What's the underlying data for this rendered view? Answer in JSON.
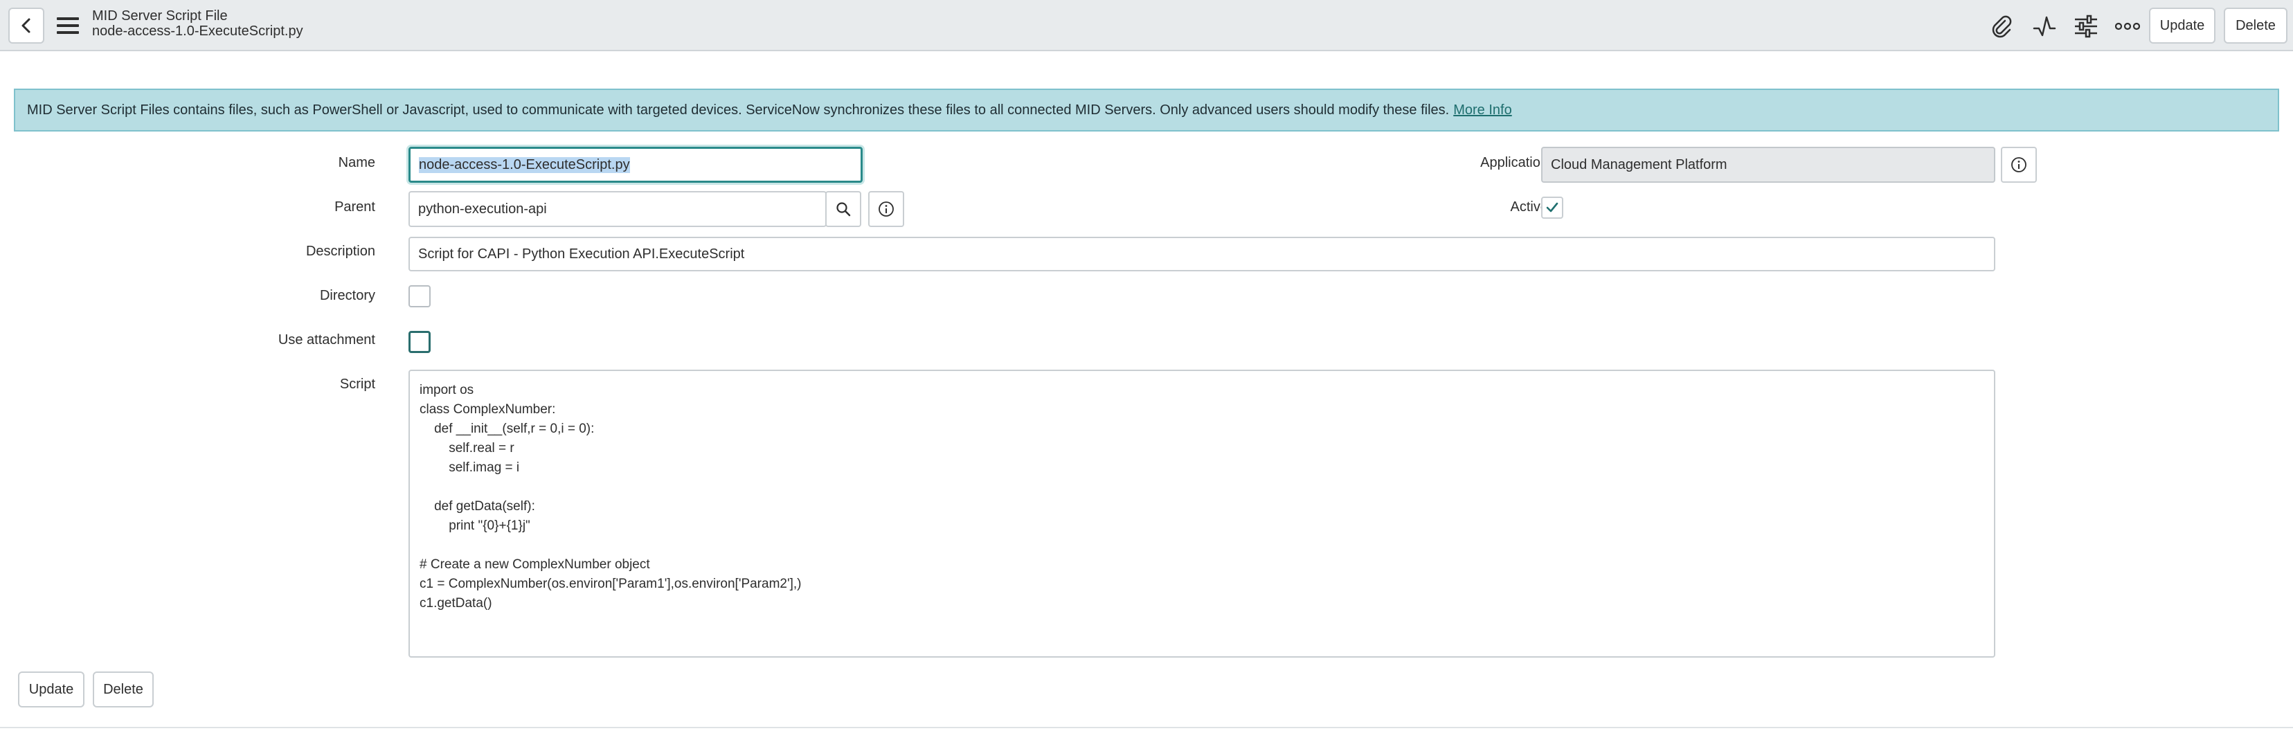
{
  "header": {
    "record_type": "MID Server Script File",
    "record_name": "node-access-1.0-ExecuteScript.py",
    "icons": [
      "back-icon",
      "hamburger-menu-icon",
      "paperclip-icon",
      "activity-pulse-icon",
      "sliders-icon",
      "more-options-icon"
    ],
    "update_label": "Update",
    "delete_label": "Delete"
  },
  "banner": {
    "text": "MID Server Script Files contains files, such as PowerShell or Javascript, used to communicate with targeted devices. ServiceNow synchronizes these files to all connected MID Servers. Only advanced users should modify these files.",
    "link_text": "More Info"
  },
  "form": {
    "name_label": "Name",
    "name_value": "node-access-1.0-ExecuteScript.py",
    "parent_label": "Parent",
    "parent_value": "python-execution-api",
    "description_label": "Description",
    "description_value": "Script for CAPI - Python Execution API.ExecuteScript",
    "directory_label": "Directory",
    "directory_checked": false,
    "use_attachment_label": "Use attachment",
    "use_attachment_checked": false,
    "script_label": "Script",
    "script_value": "import os\nclass ComplexNumber:\n    def __init__(self,r = 0,i = 0):\n        self.real = r\n        self.imag = i\n\n    def getData(self):\n        print \"{0}+{1}j\"\n\n# Create a new ComplexNumber object\nc1 = ComplexNumber(os.environ['Param1'],os.environ['Param2'],)\nc1.getData()",
    "application_label": "Application",
    "application_value": "Cloud Management Platform",
    "active_label": "Active",
    "active_checked": true
  },
  "footer": {
    "update_label": "Update",
    "delete_label": "Delete"
  },
  "colors": {
    "header_bg": "#e8ebed",
    "banner_bg": "#b7dde3",
    "accent": "#2a8a8a",
    "link": "#1e6e6e"
  }
}
